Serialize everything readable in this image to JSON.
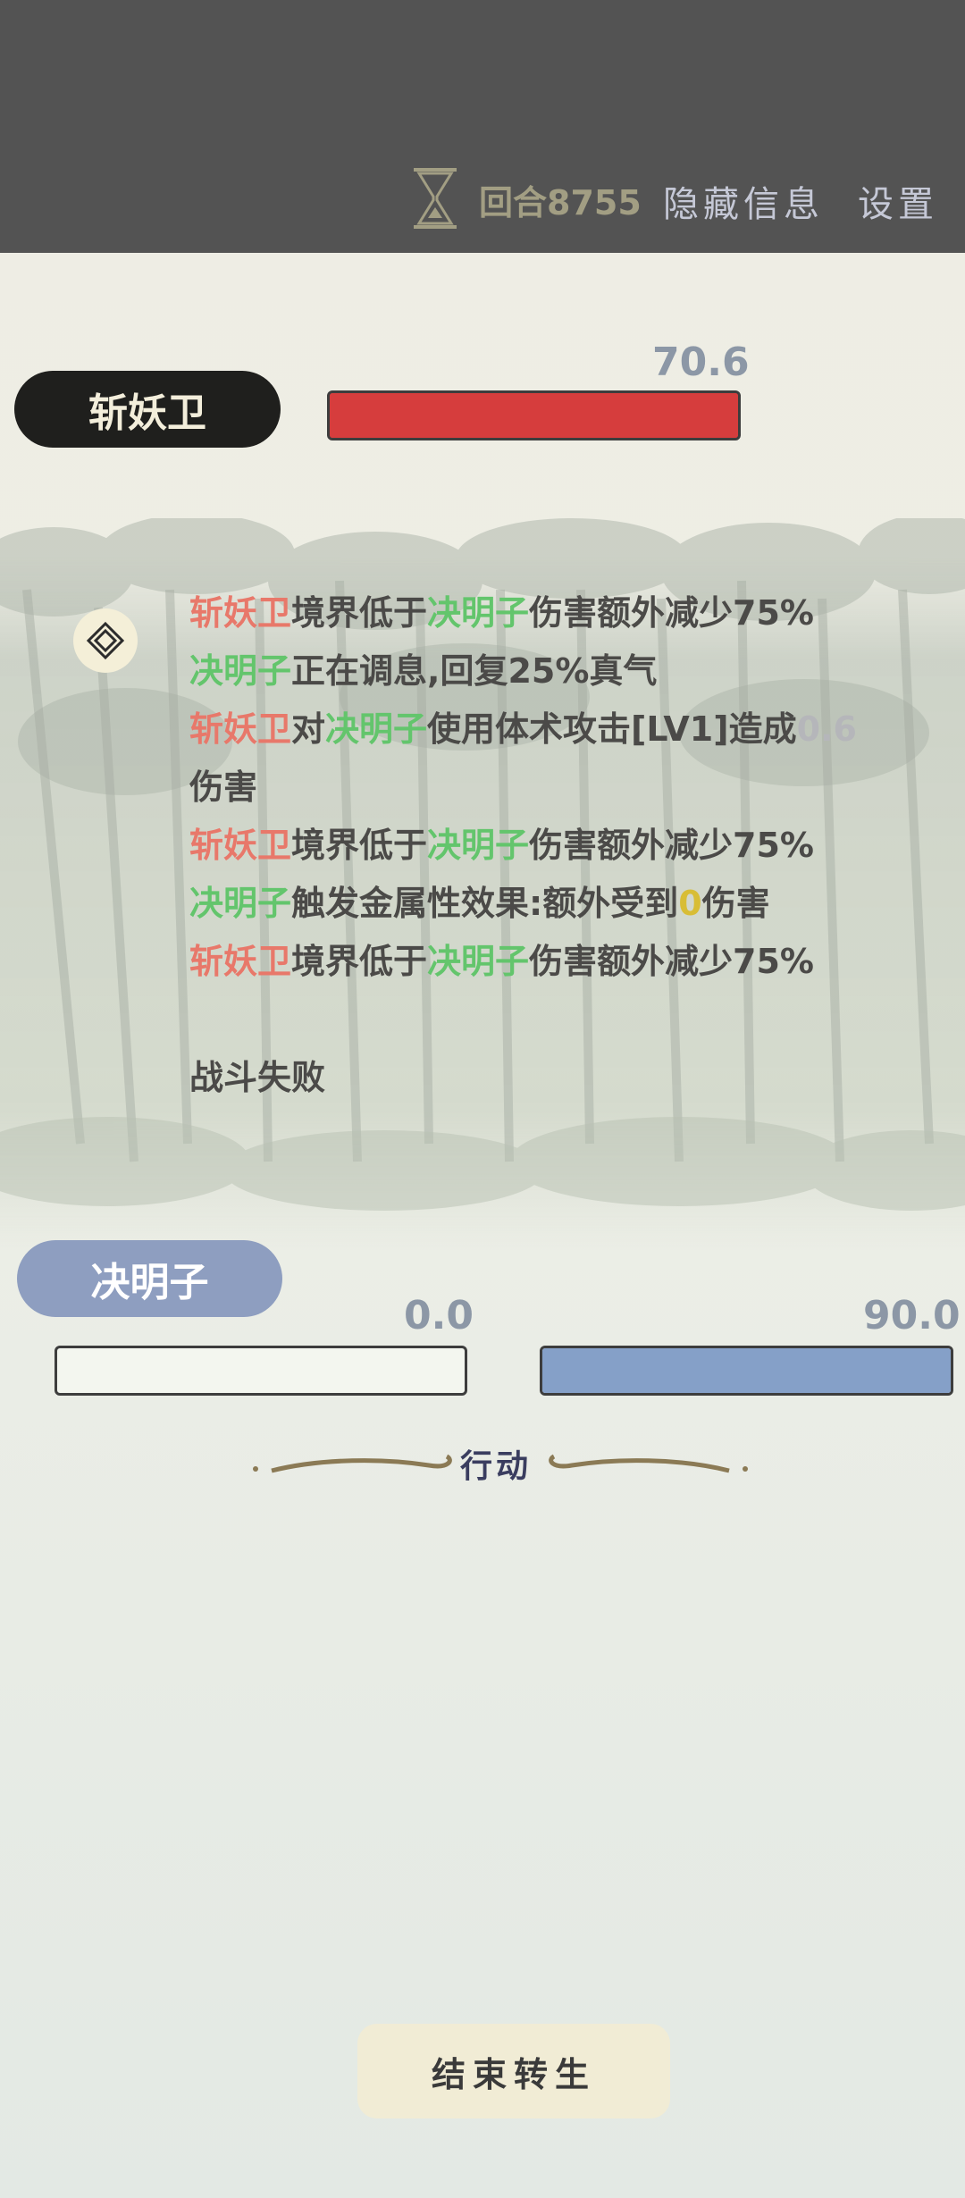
{
  "header": {
    "round_label": "回合8755",
    "hide_info_label": "隐藏信息",
    "settings_label": "设置"
  },
  "enemy": {
    "name": "斩妖卫",
    "hp_value": "70.6",
    "hp_fraction": 1.0,
    "hp_color": "#d63d3d"
  },
  "player": {
    "name": "决明子",
    "hp_value": "0.0",
    "hp_fraction": 0.0,
    "mp_value": "90.0",
    "mp_fraction": 1.0,
    "mp_color": "#85a0c8"
  },
  "log": {
    "icon": "diamond-icon",
    "line1": {
      "a": "斩妖卫",
      "b": "境界低于",
      "c": "决明子",
      "d": "伤害额外减少75%"
    },
    "line2": {
      "a": "决明子",
      "b": "正在调息,回复25%真气"
    },
    "line3": {
      "a": "斩妖卫",
      "b": "对",
      "c": "决明子",
      "d": "使用体术攻击[LV1]造成",
      "e": "0.6"
    },
    "line3_cont": "伤害",
    "line4": {
      "a": "斩妖卫",
      "b": "境界低于",
      "c": "决明子",
      "d": "伤害额外减少75%"
    },
    "line5": {
      "a": "决明子",
      "b": "触发金属性效果:额外受到",
      "c": "0",
      "d": "伤害"
    },
    "line6": {
      "a": "斩妖卫",
      "b": "境界低于",
      "c": "决明子",
      "d": "伤害额外减少75%"
    },
    "result": "战斗失败"
  },
  "action_section": {
    "label": "行动"
  },
  "end_button": {
    "label": "结束转生"
  }
}
